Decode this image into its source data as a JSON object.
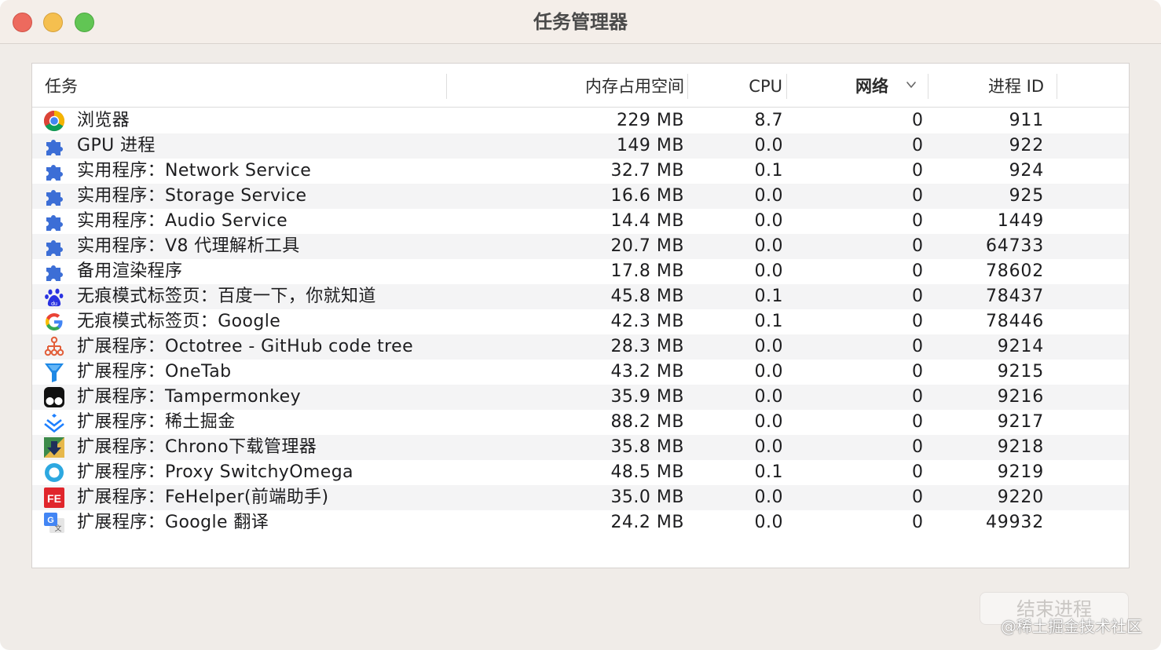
{
  "window": {
    "title": "任务管理器"
  },
  "columns": {
    "task": "任务",
    "memory": "内存占用空间",
    "cpu": "CPU",
    "network": "网络",
    "pid": "进程 ID"
  },
  "rows": [
    {
      "icon": "chrome-icon",
      "name": "浏览器",
      "memory": "229 MB",
      "cpu": "8.7",
      "network": "0",
      "pid": "911"
    },
    {
      "icon": "puzzle-icon",
      "name": "GPU 进程",
      "memory": "149 MB",
      "cpu": "0.0",
      "network": "0",
      "pid": "922"
    },
    {
      "icon": "puzzle-icon",
      "name": "实用程序：Network Service",
      "memory": "32.7 MB",
      "cpu": "0.1",
      "network": "0",
      "pid": "924"
    },
    {
      "icon": "puzzle-icon",
      "name": "实用程序：Storage Service",
      "memory": "16.6 MB",
      "cpu": "0.0",
      "network": "0",
      "pid": "925"
    },
    {
      "icon": "puzzle-icon",
      "name": "实用程序：Audio Service",
      "memory": "14.4 MB",
      "cpu": "0.0",
      "network": "0",
      "pid": "1449"
    },
    {
      "icon": "puzzle-icon",
      "name": "实用程序：V8 代理解析工具",
      "memory": "20.7 MB",
      "cpu": "0.0",
      "network": "0",
      "pid": "64733"
    },
    {
      "icon": "puzzle-icon",
      "name": "备用渲染程序",
      "memory": "17.8 MB",
      "cpu": "0.0",
      "network": "0",
      "pid": "78602"
    },
    {
      "icon": "baidu-icon",
      "name": "无痕模式标签页：百度一下，你就知道",
      "memory": "45.8 MB",
      "cpu": "0.1",
      "network": "0",
      "pid": "78437"
    },
    {
      "icon": "google-icon",
      "name": "无痕模式标签页：Google",
      "memory": "42.3 MB",
      "cpu": "0.1",
      "network": "0",
      "pid": "78446"
    },
    {
      "icon": "octotree-icon",
      "name": "扩展程序：Octotree - GitHub code tree",
      "memory": "28.3 MB",
      "cpu": "0.0",
      "network": "0",
      "pid": "9214"
    },
    {
      "icon": "onetab-icon",
      "name": "扩展程序：OneTab",
      "memory": "43.2 MB",
      "cpu": "0.0",
      "network": "0",
      "pid": "9215"
    },
    {
      "icon": "tampermonkey-icon",
      "name": "扩展程序：Tampermonkey",
      "memory": "35.9 MB",
      "cpu": "0.0",
      "network": "0",
      "pid": "9216"
    },
    {
      "icon": "juejin-icon",
      "name": "扩展程序：稀土掘金",
      "memory": "88.2 MB",
      "cpu": "0.0",
      "network": "0",
      "pid": "9217"
    },
    {
      "icon": "chrono-download-icon",
      "name": "扩展程序：Chrono下载管理器",
      "memory": "35.8 MB",
      "cpu": "0.0",
      "network": "0",
      "pid": "9218"
    },
    {
      "icon": "switchyomega-icon",
      "name": "扩展程序：Proxy SwitchyOmega",
      "memory": "48.5 MB",
      "cpu": "0.1",
      "network": "0",
      "pid": "9219"
    },
    {
      "icon": "fehelper-icon",
      "name": "扩展程序：FeHelper(前端助手)",
      "memory": "35.0 MB",
      "cpu": "0.0",
      "network": "0",
      "pid": "9220"
    },
    {
      "icon": "google-translate-icon",
      "name": "扩展程序：Google 翻译",
      "memory": "24.2 MB",
      "cpu": "0.0",
      "network": "0",
      "pid": "49932"
    }
  ],
  "end_process_button": {
    "label": "结束进程"
  },
  "watermark": "@稀土掘金技术社区"
}
